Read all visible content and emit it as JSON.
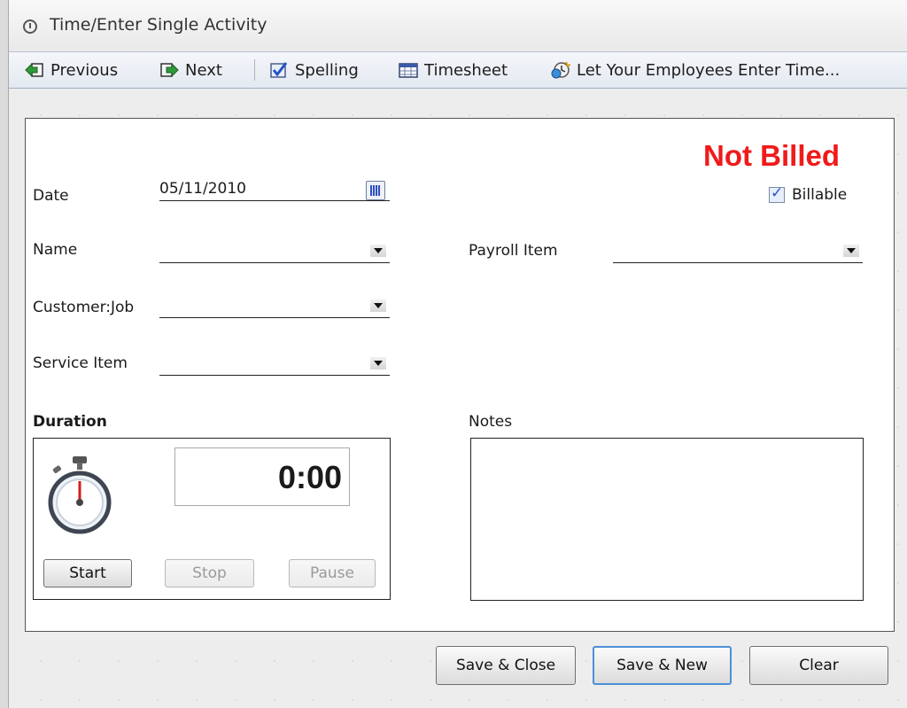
{
  "window": {
    "title": "Time/Enter Single Activity"
  },
  "toolbar": {
    "previous": "Previous",
    "next": "Next",
    "spelling": "Spelling",
    "timesheet": "Timesheet",
    "employees": "Let Your Employees Enter Time..."
  },
  "status": {
    "text": "Not Billed",
    "color": "#f01a1a"
  },
  "billable": {
    "label": "Billable",
    "checked": true
  },
  "form": {
    "date_label": "Date",
    "date_value": "05/11/2010",
    "name_label": "Name",
    "name_value": "",
    "customer_label": "Customer:Job",
    "customer_value": "",
    "service_label": "Service Item",
    "service_value": "",
    "payroll_label": "Payroll Item",
    "payroll_value": "",
    "duration_label": "Duration",
    "notes_label": "Notes"
  },
  "timer": {
    "value": "0:00",
    "start_label": "Start",
    "stop_label": "Stop",
    "pause_label": "Pause"
  },
  "buttons": {
    "save_close": "Save & Close",
    "save_new": "Save & New",
    "clear": "Clear"
  },
  "icons": {
    "title": "clock-icon",
    "previous": "arrow-left-icon",
    "next": "arrow-right-icon",
    "spelling": "spelling-check-icon",
    "timesheet": "timesheet-icon",
    "employees": "employees-time-icon",
    "calendar": "calendar-icon",
    "stopwatch": "stopwatch-icon"
  }
}
